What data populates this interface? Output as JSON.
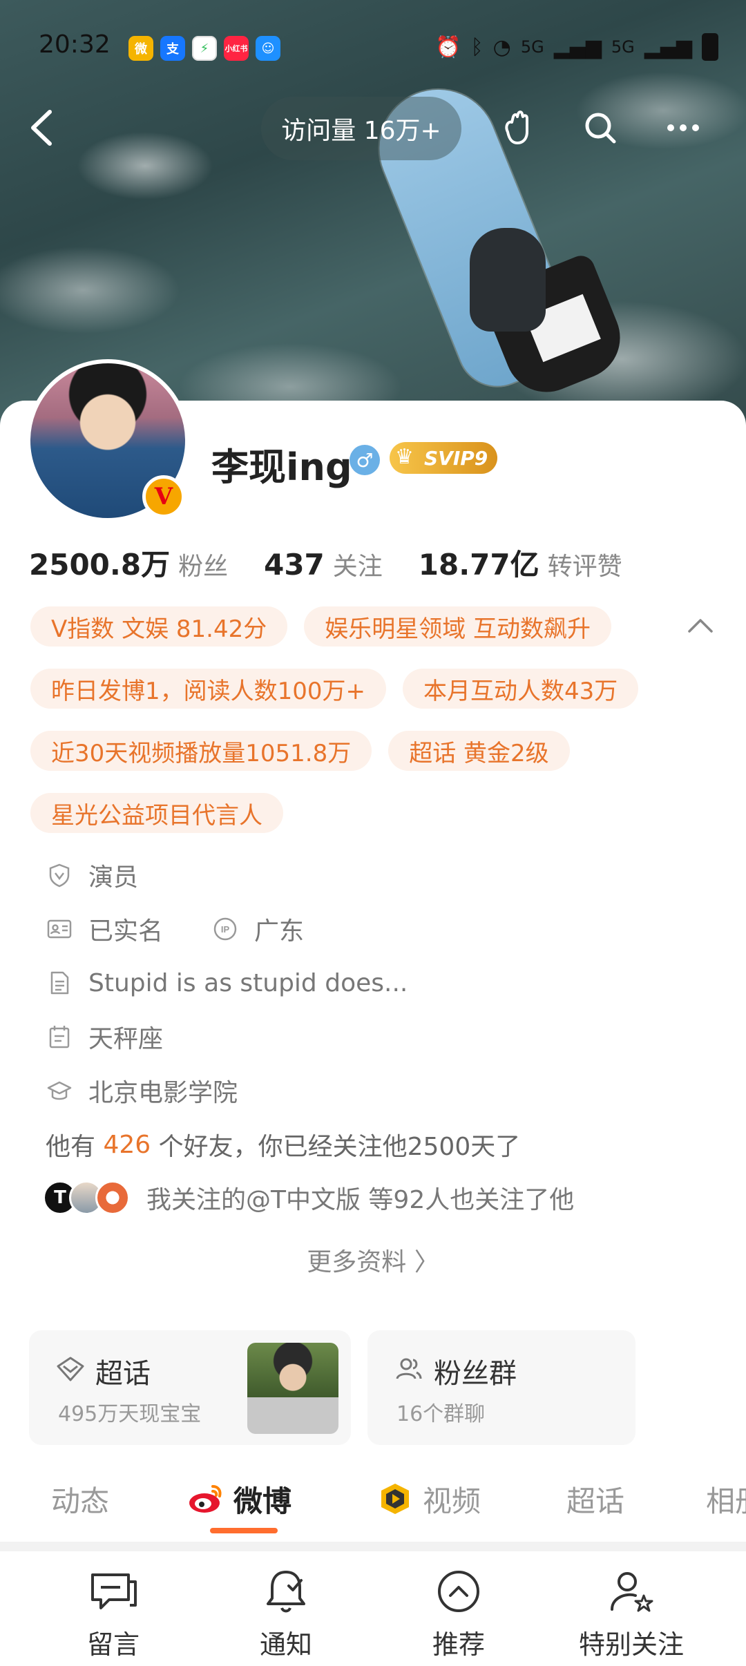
{
  "status_bar": {
    "time": "20:32",
    "apps": [
      "weibo-app-icon",
      "alipay-app-icon",
      "security-app-icon",
      "xiaohongshu-app-icon",
      "qq-app-icon"
    ],
    "network": "5G"
  },
  "nav": {
    "visit_count": "访问量 16万+"
  },
  "profile": {
    "name": "李现ing",
    "gender_symbol": "♂",
    "svip": "SVIP9",
    "verified_badge": "V"
  },
  "stats": [
    {
      "value": "2500.8万",
      "label": "粉丝"
    },
    {
      "value": "437",
      "label": "关注"
    },
    {
      "value": "18.77亿",
      "label": "转评赞"
    }
  ],
  "tags": [
    [
      "V指数 文娱 81.42分",
      "娱乐明星领域 互动数飙升"
    ],
    [
      "昨日发博1，阅读人数100万+",
      "本月互动人数43万"
    ],
    [
      "近30天视频播放量1051.8万",
      "超话 黄金2级"
    ],
    [
      "星光公益项目代言人"
    ]
  ],
  "info": {
    "occupation": "演员",
    "verified": "已实名",
    "ip_label": "广东",
    "bio": "Stupid is as stupid does...",
    "zodiac": "天秤座",
    "school": "北京电影学院",
    "friends_prefix": "他有 ",
    "friends_count": "426",
    "friends_suffix": " 个好友，你已经关注他2500天了",
    "mutual_text": "我关注的@T中文版 等92人也关注了他",
    "more": "更多资料 〉"
  },
  "features": {
    "supertopic_title": "超话",
    "supertopic_sub": "495万天现宝宝",
    "fangroup_title": "粉丝群",
    "fangroup_sub": "16个群聊"
  },
  "tabs": [
    "动态",
    "微博",
    "视频",
    "超话",
    "相册"
  ],
  "bottom_bar": [
    "留言",
    "通知",
    "推荐",
    "特别关注"
  ],
  "colors": {
    "accent": "#e8742b",
    "tag_bg": "#fdf1ea",
    "tab_underline": "#ff6d2e",
    "gender_blue": "#6ab0e6"
  }
}
